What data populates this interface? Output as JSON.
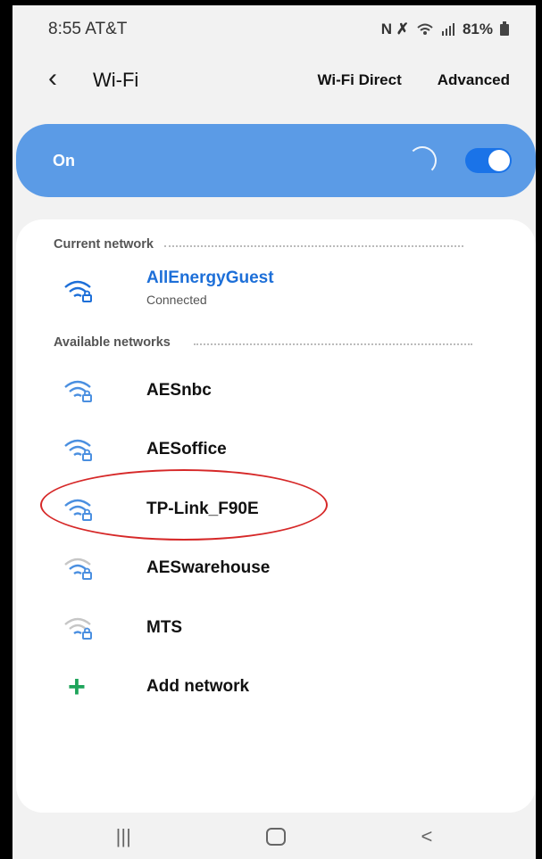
{
  "status": {
    "time": "8:55",
    "carrier": "AT&T",
    "icons_text": "N ✗",
    "battery_percent": "81%"
  },
  "header": {
    "back_icon": "chevron-left-icon",
    "title": "Wi-Fi",
    "wifi_direct": "Wi-Fi Direct",
    "advanced": "Advanced"
  },
  "wifi_switch": {
    "label": "On",
    "enabled": true,
    "accent": "#5b9be6"
  },
  "current_section": {
    "label": "Current network"
  },
  "current_network": {
    "name": "AllEnergyGuest",
    "status": "Connected",
    "signal": 3,
    "secured": true,
    "color": "#1d6fd8"
  },
  "available_section": {
    "label": "Available networks"
  },
  "networks": [
    {
      "name": "AESnbc",
      "signal": 3,
      "secured": true
    },
    {
      "name": "AESoffice",
      "signal": 3,
      "secured": true
    },
    {
      "name": "TP-Link_F90E",
      "signal": 3,
      "secured": true,
      "highlighted": true
    },
    {
      "name": "AESwarehouse",
      "signal": 2,
      "secured": true
    },
    {
      "name": "MTS",
      "signal": 1,
      "secured": true
    }
  ],
  "add_network": {
    "label": "Add network",
    "icon": "plus-icon",
    "color": "#1ea45a"
  },
  "nav": {
    "recents": "|||",
    "back": "<"
  }
}
